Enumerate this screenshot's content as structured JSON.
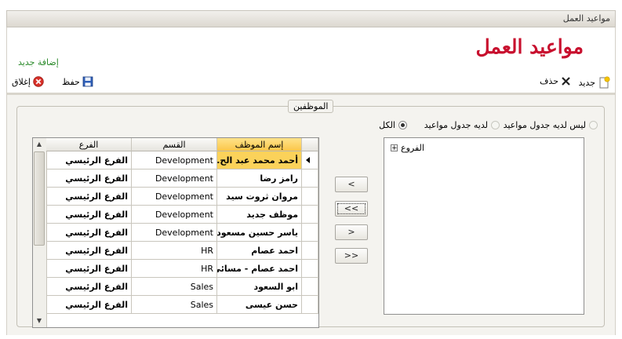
{
  "window": {
    "title": "مواعيد العمل"
  },
  "header": {
    "page_title": "مواعيد العمل",
    "add_new_link": "إضافة جديد"
  },
  "toolbar": {
    "new_label": "جديد",
    "delete_label": "حذف",
    "save_label": "حفظ",
    "close_label": "إغلاق"
  },
  "employees_group": {
    "title": "الموظفين",
    "filters": [
      {
        "label": "ليس لديه جدول مواعيد",
        "checked": false
      },
      {
        "label": "لديه جدول مواعيد",
        "checked": false
      },
      {
        "label": "الكل",
        "checked": true
      }
    ]
  },
  "transfer_buttons": {
    "move_one_left": "<",
    "move_all_left": "<<",
    "move_one_right": ">",
    "move_all_right": ">>"
  },
  "branches_tree": {
    "root_label": "الفروع"
  },
  "grid": {
    "columns": {
      "name": "إسم الموظف",
      "department": "القسم",
      "branch": "الفرع"
    },
    "rows": [
      {
        "name": "أحمد محمد عبد الح...",
        "department": "Development",
        "branch": "الفرع الرئيسي"
      },
      {
        "name": "رامز رضا",
        "department": "Development",
        "branch": "الفرع الرئيسي"
      },
      {
        "name": "مروان ثروت سيد",
        "department": "Development",
        "branch": "الفرع الرئيسي"
      },
      {
        "name": "موظف جديد",
        "department": "Development",
        "branch": "الفرع الرئيسي"
      },
      {
        "name": "ياسر حسين مسعود",
        "department": "Development",
        "branch": "الفرع الرئيسي"
      },
      {
        "name": "احمد عصام",
        "department": "HR",
        "branch": "الفرع الرئيسي"
      },
      {
        "name": "احمد عصام - مسائى",
        "department": "HR",
        "branch": "الفرع الرئيسي"
      },
      {
        "name": "ابو السعود",
        "department": "Sales",
        "branch": "الفرع الرئيسي"
      },
      {
        "name": "حسن عيسى",
        "department": "Sales",
        "branch": "الفرع الرئيسي"
      }
    ]
  },
  "colors": {
    "title_red": "#c8102e",
    "link_green": "#2a8a2a",
    "selection_yellow": "#fbd25a"
  }
}
